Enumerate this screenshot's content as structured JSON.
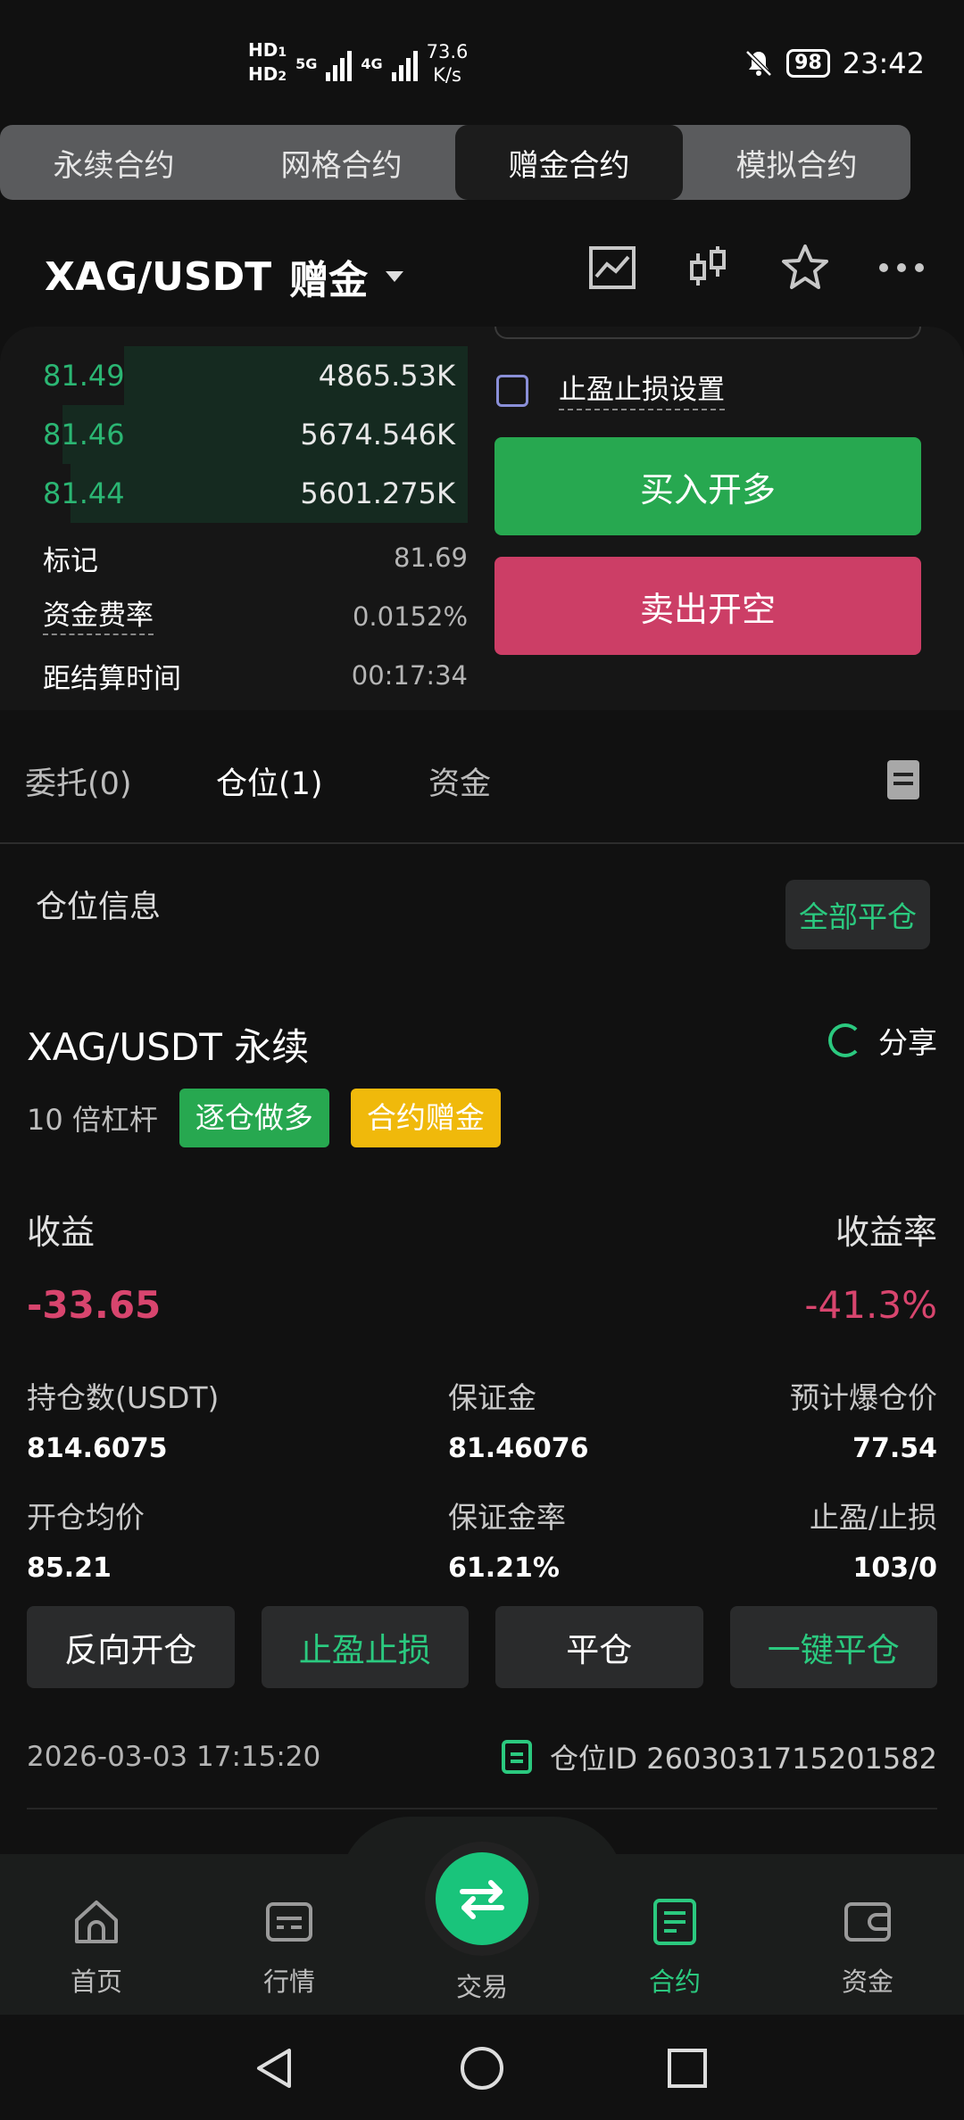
{
  "status_bar": {
    "hd1": "HD",
    "hd1_sub": "1",
    "hd2": "HD",
    "hd2_sub": "2",
    "net1": "5G",
    "net2": "4G",
    "speed_value": "73.6",
    "speed_unit": "K/s",
    "battery": "98",
    "time": "23:42"
  },
  "contract_tabs": [
    {
      "label": "永续合约"
    },
    {
      "label": "网格合约"
    },
    {
      "label": "赠金合约",
      "active": true
    },
    {
      "label": "模拟合约"
    }
  ],
  "header": {
    "pair": "XAG/USDT",
    "mode": "赠金"
  },
  "order_book": [
    {
      "price": "81.49",
      "amount": "4865.53K",
      "depth": 0.78
    },
    {
      "price": "81.46",
      "amount": "5674.546K",
      "depth": 0.92
    },
    {
      "price": "81.44",
      "amount": "5601.275K",
      "depth": 0.9
    }
  ],
  "stats": {
    "mark_label": "标记",
    "mark_value": "81.69",
    "funding_label": "资金费率",
    "funding_value": "0.0152%",
    "settle_label": "距结算时间",
    "settle_value": "00:17:34"
  },
  "order_form": {
    "tp_sl_label": "止盈止损设置",
    "buy_label": "买入开多",
    "sell_label": "卖出开空"
  },
  "section_tabs": {
    "orders": "委托(0)",
    "positions": "仓位(1)",
    "funds": "资金"
  },
  "position_head": {
    "title": "仓位信息",
    "close_all": "全部平仓"
  },
  "position": {
    "pair": "XAG/USDT 永续",
    "share": "分享",
    "leverage": "10 倍杠杆",
    "tag_mode": "逐仓做多",
    "tag_bonus": "合约赠金",
    "pnl_label": "收益",
    "pnl_rate_label": "收益率",
    "pnl_value": "-33.65",
    "pnl_rate_value": "-41.3%",
    "size_label": "持仓数(USDT)",
    "size_value": "814.6075",
    "margin_label": "保证金",
    "margin_value": "81.46076",
    "liq_label": "预计爆仓价",
    "liq_value": "77.54",
    "entry_label": "开仓均价",
    "entry_value": "85.21",
    "margin_rate_label": "保证金率",
    "margin_rate_value": "61.21%",
    "tpsl_label": "止盈/止损",
    "tpsl_value": "103/0",
    "btn_reverse": "反向开仓",
    "btn_tpsl": "止盈止损",
    "btn_close": "平仓",
    "btn_oneclick": "一键平仓",
    "time": "2026-03-03 17:15:20",
    "position_id": "仓位ID 2603031715201582"
  },
  "bottom_nav": {
    "home": "首页",
    "market": "行情",
    "trade": "交易",
    "contract": "合约",
    "assets": "资金"
  },
  "colors": {
    "green": "#2bc97f",
    "buy": "#27a850",
    "sell": "#cc3e66",
    "loss": "#d8456e",
    "bonus": "#f0b90b"
  }
}
